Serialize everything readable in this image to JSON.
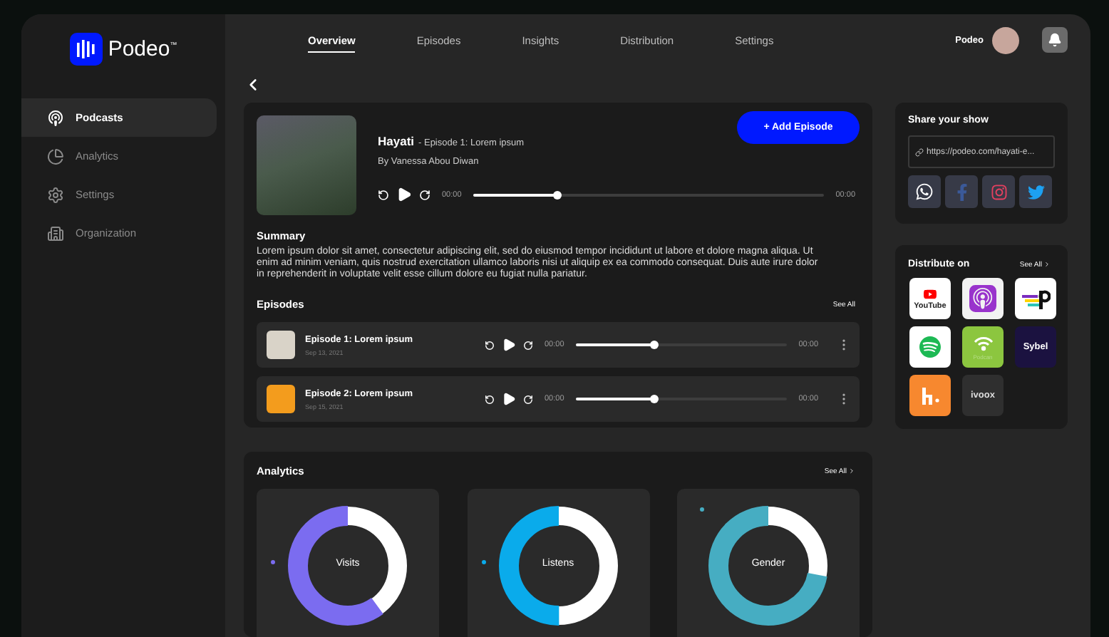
{
  "logo": {
    "name": "Podeo$^{™}$"
  },
  "nav": {
    "tabs": [
      {
        "label": "Overview",
        "selected": true
      },
      {
        "label": "Episodes",
        "selected": false
      },
      {
        "label": "Insights",
        "selected": false
      },
      {
        "label": "Distribution",
        "selected": false
      },
      {
        "label": "Settings",
        "selected": false
      }
    ]
  },
  "user": {
    "name": "Podeo"
  },
  "sidebar": {
    "items": [
      {
        "kind": "podcasts",
        "label": "Podcasts",
        "selected": true
      },
      {
        "kind": "analytics",
        "label": "Analytics",
        "selected": false
      },
      {
        "kind": "settings",
        "label": "Settings",
        "selected": false
      },
      {
        "kind": "organization",
        "label": "Organization",
        "selected": false
      }
    ]
  },
  "episode_header": {
    "show": "Hayati",
    "episode": "- Episode 1: Lorem ipsum",
    "author": "By Vanessa Abou Diwan",
    "button": "+ Add Episode",
    "player": {
      "elapsed": "00:00",
      "level": 0.24,
      "total": "00:00"
    }
  },
  "summary": {
    "title": "Summary",
    "text": "Lorem ipsum dolor sit amet, consectetur adipiscing elit, sed do eiusmod tempor incididunt ut labore et dolore magna aliqua. Ut enim ad minim veniam, quis nostrud exercitation ullamco laboris nisi ut aliquip ex ea commodo consequat. Duis aute irure dolor in reprehenderit in voluptate velit esse cillum dolore eu fugiat nulla pariatur."
  },
  "episodes": {
    "title": "Episodes",
    "see_all": "See All",
    "items": [
      {
        "title": "Episode 1: Lorem ipsum",
        "date": "Sep 13, 2021",
        "elapsed": "00:00",
        "level": 0.37,
        "total": "00:00"
      },
      {
        "title": "Episode 2: Lorem ipsum",
        "date": "Sep 15, 2021",
        "elapsed": "00:00",
        "level": 0.37,
        "total": "00:00"
      }
    ]
  },
  "share": {
    "title": "Share your show",
    "url": "https://podeo.com/hayati-e...",
    "networks": [
      {
        "kind": "whatsapp"
      },
      {
        "kind": "facebook"
      },
      {
        "kind": "instagram"
      },
      {
        "kind": "twitter"
      }
    ]
  },
  "distribute": {
    "title": "Distribute on",
    "see_all": "See All",
    "platforms": [
      {
        "kind": "youtube",
        "label": "YouTube"
      },
      {
        "kind": "apple"
      },
      {
        "kind": "lines"
      },
      {
        "kind": "spotify"
      },
      {
        "kind": "podcan",
        "label": "Podcan"
      },
      {
        "kind": "sybel",
        "label": "Sybel"
      },
      {
        "kind": "h"
      },
      {
        "kind": "ivoox",
        "label": "ivoox"
      }
    ]
  },
  "analytics": {
    "title": "Analytics",
    "see_all": "See All",
    "cards": [
      {
        "label": "Visits",
        "color": "#7b6cf0"
      },
      {
        "label": "Listens",
        "color": "#0aabeb"
      },
      {
        "label": "Gender",
        "color": "#46adc2"
      }
    ]
  }
}
